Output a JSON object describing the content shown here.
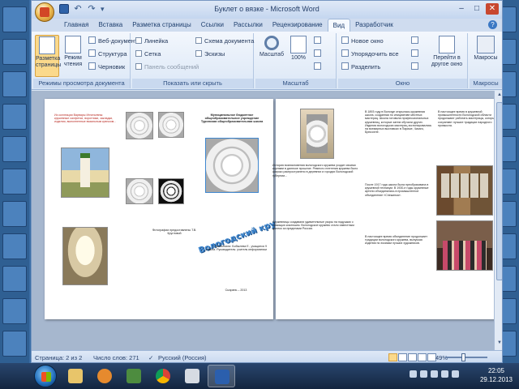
{
  "window": {
    "title": "Буклет о вязке - Microsoft Word"
  },
  "quick_access": {
    "save_icon": "save-icon",
    "undo_icon": "undo-icon",
    "redo_icon": "redo-icon"
  },
  "tabs": [
    {
      "label": "Главная"
    },
    {
      "label": "Вставка"
    },
    {
      "label": "Разметка страницы"
    },
    {
      "label": "Ссылки"
    },
    {
      "label": "Рассылки"
    },
    {
      "label": "Рецензирование"
    },
    {
      "label": "Вид",
      "active": true
    },
    {
      "label": "Разработчик"
    }
  ],
  "ribbon": {
    "view_modes": {
      "label": "Режимы просмотра документа",
      "print_layout": "Разметка страницы",
      "reading": "Режим чтения",
      "web": "Веб-документ",
      "outline": "Структура",
      "draft": "Черновик"
    },
    "show_hide": {
      "label": "Показать или скрыть",
      "ruler": "Линейка",
      "grid": "Сетка",
      "message_bar": "Панель сообщений",
      "doc_map": "Схема документа",
      "thumbnails": "Эскизы"
    },
    "zoom": {
      "label": "Масштаб",
      "zoom_btn": "Масштаб",
      "hundred": "100%"
    },
    "window": {
      "label": "Окно",
      "new_window": "Новое окно",
      "arrange_all": "Упорядочить все",
      "split": "Разделить",
      "switch": "Перейти в другое окно"
    },
    "macros": {
      "label": "Макросы",
      "btn": "Макросы"
    }
  },
  "page1": {
    "intro_text": "Из коллекции Варвары Игнатьевны: кружевные салфетки, воротники, закладки, изделия, выполненные вязальным крючком...",
    "org": "Муниципальное бюджетное общеобразовательное учреждение Туринская общеобразовательная школа",
    "wordart": "Вологодский кружевной",
    "photos_credit": "Фотографии предоставлены Т.В. Кругловой",
    "authors": "Выполнили: Бобылева Е., учащиеся 9 класса. Руководитель: учитель информатики",
    "year": "Сызрань – 2013",
    "history": "История возникновения вологодского кружева уходит своими корнями в далекое прошлое. Ремесло плетения кружева было широко распространено в деревнях и городах Вологодской губернии...",
    "history2": "Кружевницы создавали удивительные узоры на подушках с помощью коклюшек. Вологодское кружево стало известным далеко за пределами России."
  },
  "page2": {
    "col1": "В 1893 году в Вологде открылась кружевная школа, созданная по инициативе местных мастериц. Школа готовила профессиональных кружевниц, которые затем обучали других. Изделия вологодских мастериц экспонировались на всемирных выставках в Париже, Чикаго, Брюсселе.",
    "col1b": "После 1917 года школа была преобразована в кружевной техникум. В 1930-е годы кружевные артели объединились в промышленное объединение «Снежинка».",
    "col1c": "В настоящее время объединение продолжает традиции вологодского кружева, выпуская изделия по эскизам лучших художников.",
    "col2": "В настоящее время в кружевной промышленности Вологодской области продолжают работать мастерицы, которые сохраняют лучшие традиции народного промысла."
  },
  "status": {
    "page": "Страница: 2 из 2",
    "words": "Число слов: 271",
    "language": "Русский (Россия)",
    "zoom": "49%"
  },
  "taskbar": {
    "time": "22:05",
    "date": "29.12.2013"
  },
  "colors": {
    "accent": "#fbd98b",
    "wordart": "#3f87cf",
    "link_red": "#b92a22"
  }
}
